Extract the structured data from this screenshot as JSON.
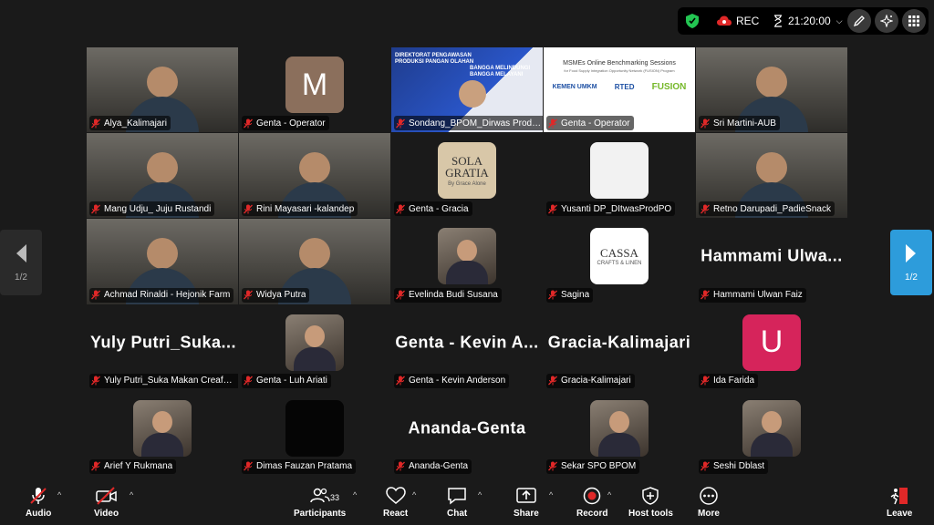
{
  "topbar": {
    "rec_label": "REC",
    "timer": "21:20:00"
  },
  "tiles": [
    {
      "name": "Alya_Kalimajari",
      "type": "video"
    },
    {
      "name": "Genta - Operator",
      "type": "avatar",
      "initial": "M",
      "color": "#8b6f5c"
    },
    {
      "name": "Sondang_BPOM_Dirwas Produ...",
      "type": "slide",
      "slide_title": "DIREKTORAT PENGAWASAN PRODUKSI PANGAN OLAHAN",
      "slide_tagline": "BANGGA MELINDUNGI BANGGA MELAYANI"
    },
    {
      "name": "Genta - Operator",
      "type": "slide2",
      "slide_title": "MSMEs Online Benchmarking Sessions",
      "slide_sub": "for Food Supply Integration Opportunity Network (FUSION) Program",
      "logo_a": "KEMEN UMKM",
      "logo_b": "RTED",
      "logo_c": "FUSION"
    },
    {
      "name": "Sri Martini-AUB",
      "type": "video"
    },
    {
      "name": "Mang Udju_ Juju Rustandi",
      "type": "video"
    },
    {
      "name": "Rini Mayasari -kalandep",
      "type": "video"
    },
    {
      "name": "Genta - Gracia",
      "type": "logo",
      "logo_text": "SOLA GRATIA",
      "logo_sub": "By Grace Alone",
      "color": "#d8c7a8"
    },
    {
      "name": "Yusanti DP_DItwasProdPO",
      "type": "logo",
      "logo_text": "",
      "logo_sub": "",
      "color": "#f2f2f2"
    },
    {
      "name": "Retno Darupadi_PadieSnack",
      "type": "video"
    },
    {
      "name": "Achmad Rinaldi - Hejonik Farm",
      "type": "video"
    },
    {
      "name": "Widya Putra",
      "type": "video"
    },
    {
      "name": "Evelinda Budi Susana",
      "type": "photo"
    },
    {
      "name": "Sagina",
      "type": "logo",
      "logo_text": "CASSA",
      "logo_sub": "CRAFTS & LINEN",
      "color": "#ffffff"
    },
    {
      "name": "Hammami Ulwan Faiz",
      "type": "text",
      "display": "Hammami  Ulwa..."
    },
    {
      "name": "Yuly Putri_Suka Makan Creafood",
      "type": "text",
      "display": "Yuly  Putri_Suka..."
    },
    {
      "name": "Genta - Luh Ariati",
      "type": "photo"
    },
    {
      "name": "Genta - Kevin Anderson",
      "type": "text",
      "display": "Genta  -  Kevin  A..."
    },
    {
      "name": "Gracia-Kalimajari",
      "type": "text",
      "display": "Gracia-Kalimajari"
    },
    {
      "name": "Ida Farida",
      "type": "avatar",
      "initial": "U",
      "color": "#d6245b"
    },
    {
      "name": "Arief Y Rukmana",
      "type": "photo"
    },
    {
      "name": "Dimas Fauzan Pratama",
      "type": "black"
    },
    {
      "name": "Ananda-Genta",
      "type": "text",
      "display": "Ananda-Genta"
    },
    {
      "name": "Sekar SPO BPOM",
      "type": "photo"
    },
    {
      "name": "Seshi Dblast",
      "type": "photo"
    }
  ],
  "page_nav": {
    "left_label": "1/2",
    "right_label": "1/2"
  },
  "toolbar": {
    "audio": "Audio",
    "video": "Video",
    "participants": "Participants",
    "participants_count": "33",
    "react": "React",
    "chat": "Chat",
    "share": "Share",
    "record": "Record",
    "host_tools": "Host tools",
    "more": "More",
    "leave": "Leave"
  },
  "colors": {
    "background": "#1a1a1a",
    "active_speaker": "#2bd45c",
    "accent": "#2d9cdb",
    "muted_red": "#e02828"
  }
}
